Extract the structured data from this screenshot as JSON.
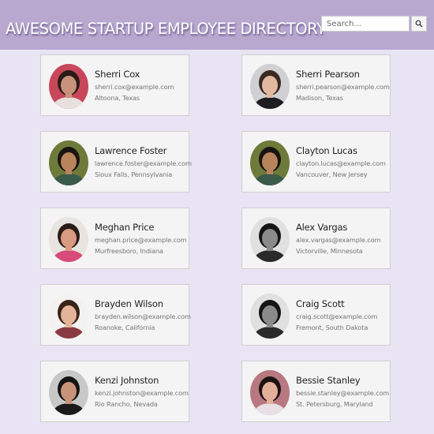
{
  "header": {
    "title": "AWESOME STARTUP EMPLOYEE DIRECTORY",
    "search_placeholder": "Search..."
  },
  "employees": [
    {
      "name": "Sherri Cox",
      "email": "sherri.cox@example.com",
      "location": "Altoona, Texas",
      "avatar": {
        "bg": "#c8475a",
        "hair": "#2a1a18",
        "skin": "#c8927a",
        "shirt": "#e8e0dc"
      }
    },
    {
      "name": "Sherri Pearson",
      "email": "sherri.pearson@example.com",
      "location": "Madison, Texas",
      "avatar": {
        "bg": "#d0cfd2",
        "hair": "#3a2a24",
        "skin": "#e2b8a0",
        "shirt": "#1e1e22"
      }
    },
    {
      "name": "Lawrence Foster",
      "email": "lawrence.foster@example.com",
      "location": "Sioux Falls, Pennsylvania",
      "avatar": {
        "bg": "#6e7a3a",
        "hair": "#1a1410",
        "skin": "#b8845c",
        "shirt": "#3a5a4a"
      }
    },
    {
      "name": "Clayton Lucas",
      "email": "clayton.lucas@example.com",
      "location": "Vancouver, New Jersey",
      "avatar": {
        "bg": "#6e7a3a",
        "hair": "#1a1410",
        "skin": "#b8845c",
        "shirt": "#3a5a4a"
      }
    },
    {
      "name": "Meghan Price",
      "email": "meghan.price@example.com",
      "location": "Murfreesboro, Indiana",
      "avatar": {
        "bg": "#e8e4e0",
        "hair": "#2a1c18",
        "skin": "#d89a80",
        "shirt": "#d84a7a"
      }
    },
    {
      "name": "Alex Vargas",
      "email": "alex.vargas@example.com",
      "location": "Victorville, Minnesota",
      "avatar": {
        "bg": "#e0e0e0",
        "hair": "#151515",
        "skin": "#8a8a8a",
        "shirt": "#2a2a2a"
      }
    },
    {
      "name": "Brayden Wilson",
      "email": "brayden.wilson@example.com",
      "location": "Roanoke, California",
      "avatar": {
        "bg": "#f4f2f0",
        "hair": "#3a2418",
        "skin": "#e4b498",
        "shirt": "#8a3a42"
      }
    },
    {
      "name": "Craig Scott",
      "email": "craig.scott@example.com",
      "location": "Fremont, South Dakota",
      "avatar": {
        "bg": "#e0e0e0",
        "hair": "#151515",
        "skin": "#8a8a8a",
        "shirt": "#2a2a2a"
      }
    },
    {
      "name": "Kenzi Johnston",
      "email": "kenzi.johnston@example.com",
      "location": "Rio Rancho, Nevada",
      "avatar": {
        "bg": "#c8c8c8",
        "hair": "#141414",
        "skin": "#c89478",
        "shirt": "#1a1a1a"
      }
    },
    {
      "name": "Bessie Stanley",
      "email": "bessie.stanley@example.com",
      "location": "St. Petersburg, Maryland",
      "avatar": {
        "bg": "#b87880",
        "hair": "#1c1212",
        "skin": "#e2b09a",
        "shirt": "#e8e0e4"
      }
    }
  ]
}
